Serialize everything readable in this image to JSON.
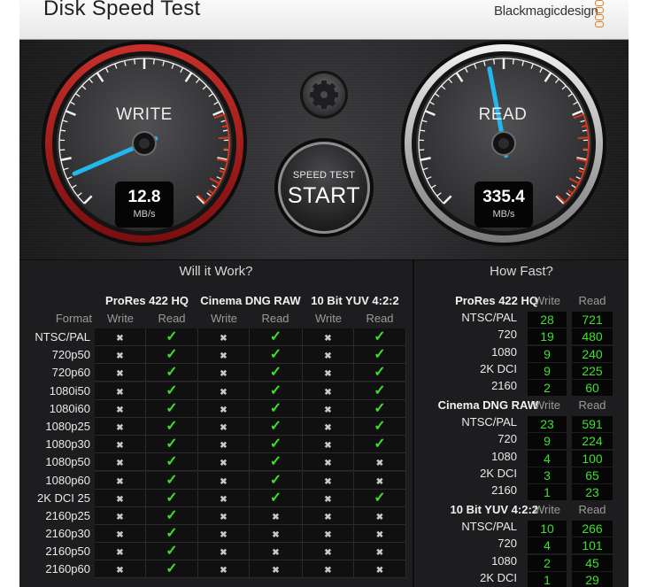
{
  "window": {
    "title": "Disk Speed Test",
    "brand": "Blackmagicdesign"
  },
  "gauges": {
    "write": {
      "label": "WRITE",
      "value": "12.8",
      "unit": "MB/s",
      "needle_fraction": 0.08
    },
    "read": {
      "label": "READ",
      "value": "335.4",
      "unit": "MB/s",
      "needle_fraction": 0.46
    }
  },
  "start_button": {
    "small": "SPEED TEST",
    "big": "START"
  },
  "settings_button": {
    "icon": "gear-icon"
  },
  "will_it_work": {
    "title": "Will it Work?",
    "format_header": "Format",
    "groups": [
      "ProRes 422 HQ",
      "Cinema DNG RAW",
      "10 Bit YUV 4:2:2"
    ],
    "sub_headers": [
      "Write",
      "Read",
      "Write",
      "Read",
      "Write",
      "Read"
    ],
    "rows": [
      {
        "format": "NTSC/PAL",
        "cells": [
          "x",
          "ok",
          "x",
          "ok",
          "x",
          "ok"
        ]
      },
      {
        "format": "720p50",
        "cells": [
          "x",
          "ok",
          "x",
          "ok",
          "x",
          "ok"
        ]
      },
      {
        "format": "720p60",
        "cells": [
          "x",
          "ok",
          "x",
          "ok",
          "x",
          "ok"
        ]
      },
      {
        "format": "1080i50",
        "cells": [
          "x",
          "ok",
          "x",
          "ok",
          "x",
          "ok"
        ]
      },
      {
        "format": "1080i60",
        "cells": [
          "x",
          "ok",
          "x",
          "ok",
          "x",
          "ok"
        ]
      },
      {
        "format": "1080p25",
        "cells": [
          "x",
          "ok",
          "x",
          "ok",
          "x",
          "ok"
        ]
      },
      {
        "format": "1080p30",
        "cells": [
          "x",
          "ok",
          "x",
          "ok",
          "x",
          "ok"
        ]
      },
      {
        "format": "1080p50",
        "cells": [
          "x",
          "ok",
          "x",
          "ok",
          "x",
          "x"
        ]
      },
      {
        "format": "1080p60",
        "cells": [
          "x",
          "ok",
          "x",
          "ok",
          "x",
          "x"
        ]
      },
      {
        "format": "2K DCI 25",
        "cells": [
          "x",
          "ok",
          "x",
          "ok",
          "x",
          "ok"
        ]
      },
      {
        "format": "2160p25",
        "cells": [
          "x",
          "ok",
          "x",
          "x",
          "x",
          "x"
        ]
      },
      {
        "format": "2160p30",
        "cells": [
          "x",
          "ok",
          "x",
          "x",
          "x",
          "x"
        ]
      },
      {
        "format": "2160p50",
        "cells": [
          "x",
          "ok",
          "x",
          "x",
          "x",
          "x"
        ]
      },
      {
        "format": "2160p60",
        "cells": [
          "x",
          "ok",
          "x",
          "x",
          "x",
          "x"
        ]
      }
    ]
  },
  "how_fast": {
    "title": "How Fast?",
    "sections": [
      {
        "name": "ProRes 422 HQ",
        "write_label": "Write",
        "read_label": "Read",
        "rows": [
          {
            "label": "NTSC/PAL",
            "write": "28",
            "read": "721"
          },
          {
            "label": "720",
            "write": "19",
            "read": "480"
          },
          {
            "label": "1080",
            "write": "9",
            "read": "240"
          },
          {
            "label": "2K DCI",
            "write": "9",
            "read": "225"
          },
          {
            "label": "2160",
            "write": "2",
            "read": "60"
          }
        ]
      },
      {
        "name": "Cinema DNG RAW",
        "write_label": "Write",
        "read_label": "Read",
        "rows": [
          {
            "label": "NTSC/PAL",
            "write": "23",
            "read": "591"
          },
          {
            "label": "720",
            "write": "9",
            "read": "224"
          },
          {
            "label": "1080",
            "write": "4",
            "read": "100"
          },
          {
            "label": "2K DCI",
            "write": "3",
            "read": "65"
          },
          {
            "label": "2160",
            "write": "1",
            "read": "23"
          }
        ]
      },
      {
        "name": "10 Bit YUV 4:2:2",
        "write_label": "Write",
        "read_label": "Read",
        "rows": [
          {
            "label": "NTSC/PAL",
            "write": "10",
            "read": "266"
          },
          {
            "label": "720",
            "write": "4",
            "read": "101"
          },
          {
            "label": "1080",
            "write": "2",
            "read": "45"
          },
          {
            "label": "2K DCI",
            "write": "1",
            "read": "29"
          }
        ]
      }
    ]
  },
  "colors": {
    "write_ring": "#b51a1a",
    "needle": "#23b7f0",
    "ok": "#3edc2c",
    "redline": "#d9361c"
  }
}
